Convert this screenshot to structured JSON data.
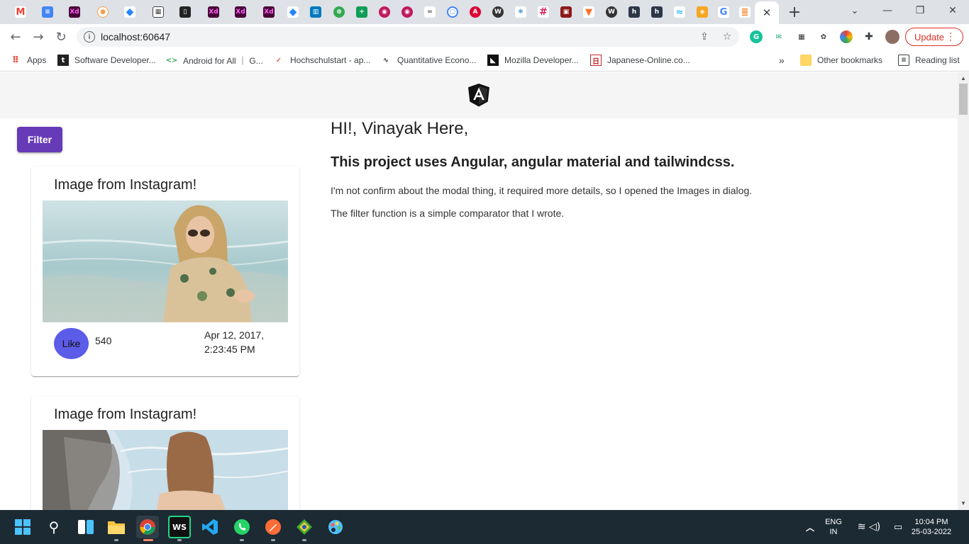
{
  "browser": {
    "active_tab_close": "✕",
    "new_tab": "+",
    "window_controls": [
      "⌄",
      "—",
      "❐",
      "✕"
    ],
    "url": "localhost:60647",
    "update_label": "Update"
  },
  "bookmarks": {
    "apps_label": "Apps",
    "items": [
      "Software Developer...",
      "Android for All ｜ G...",
      "Hochschulstart - ap...",
      "Quantitative Econo...",
      "Mozilla Developer...",
      "Japanese-Online.co..."
    ],
    "more": "»",
    "other_label": "Other bookmarks",
    "reading_list_label": "Reading list"
  },
  "app": {
    "filter_label": "Filter",
    "cards": [
      {
        "title": "Image from Instagram!",
        "like_label": "Like",
        "likes": "540",
        "date": "Apr 12, 2017, 2:23:45 PM"
      },
      {
        "title": "Image from Instagram!"
      }
    ],
    "intro": {
      "heading": "HI!, Vinayak Here,",
      "subheading": "This project uses Angular, angular material and tailwindcss.",
      "paragraphs": [
        "I'm not confirm about the modal thing, it required more details, so I opened the Images in dialog.",
        "The filter function is a simple comparator that I wrote."
      ]
    }
  },
  "taskbar": {
    "lang_line1": "ENG",
    "lang_line2": "IN",
    "time": "10:04 PM",
    "date": "25-03-2022"
  },
  "colors": {
    "primary_button": "#673ab7",
    "like_button": "#5b5ce8",
    "update_red": "#d93025",
    "taskbar": "#1c2a34"
  }
}
